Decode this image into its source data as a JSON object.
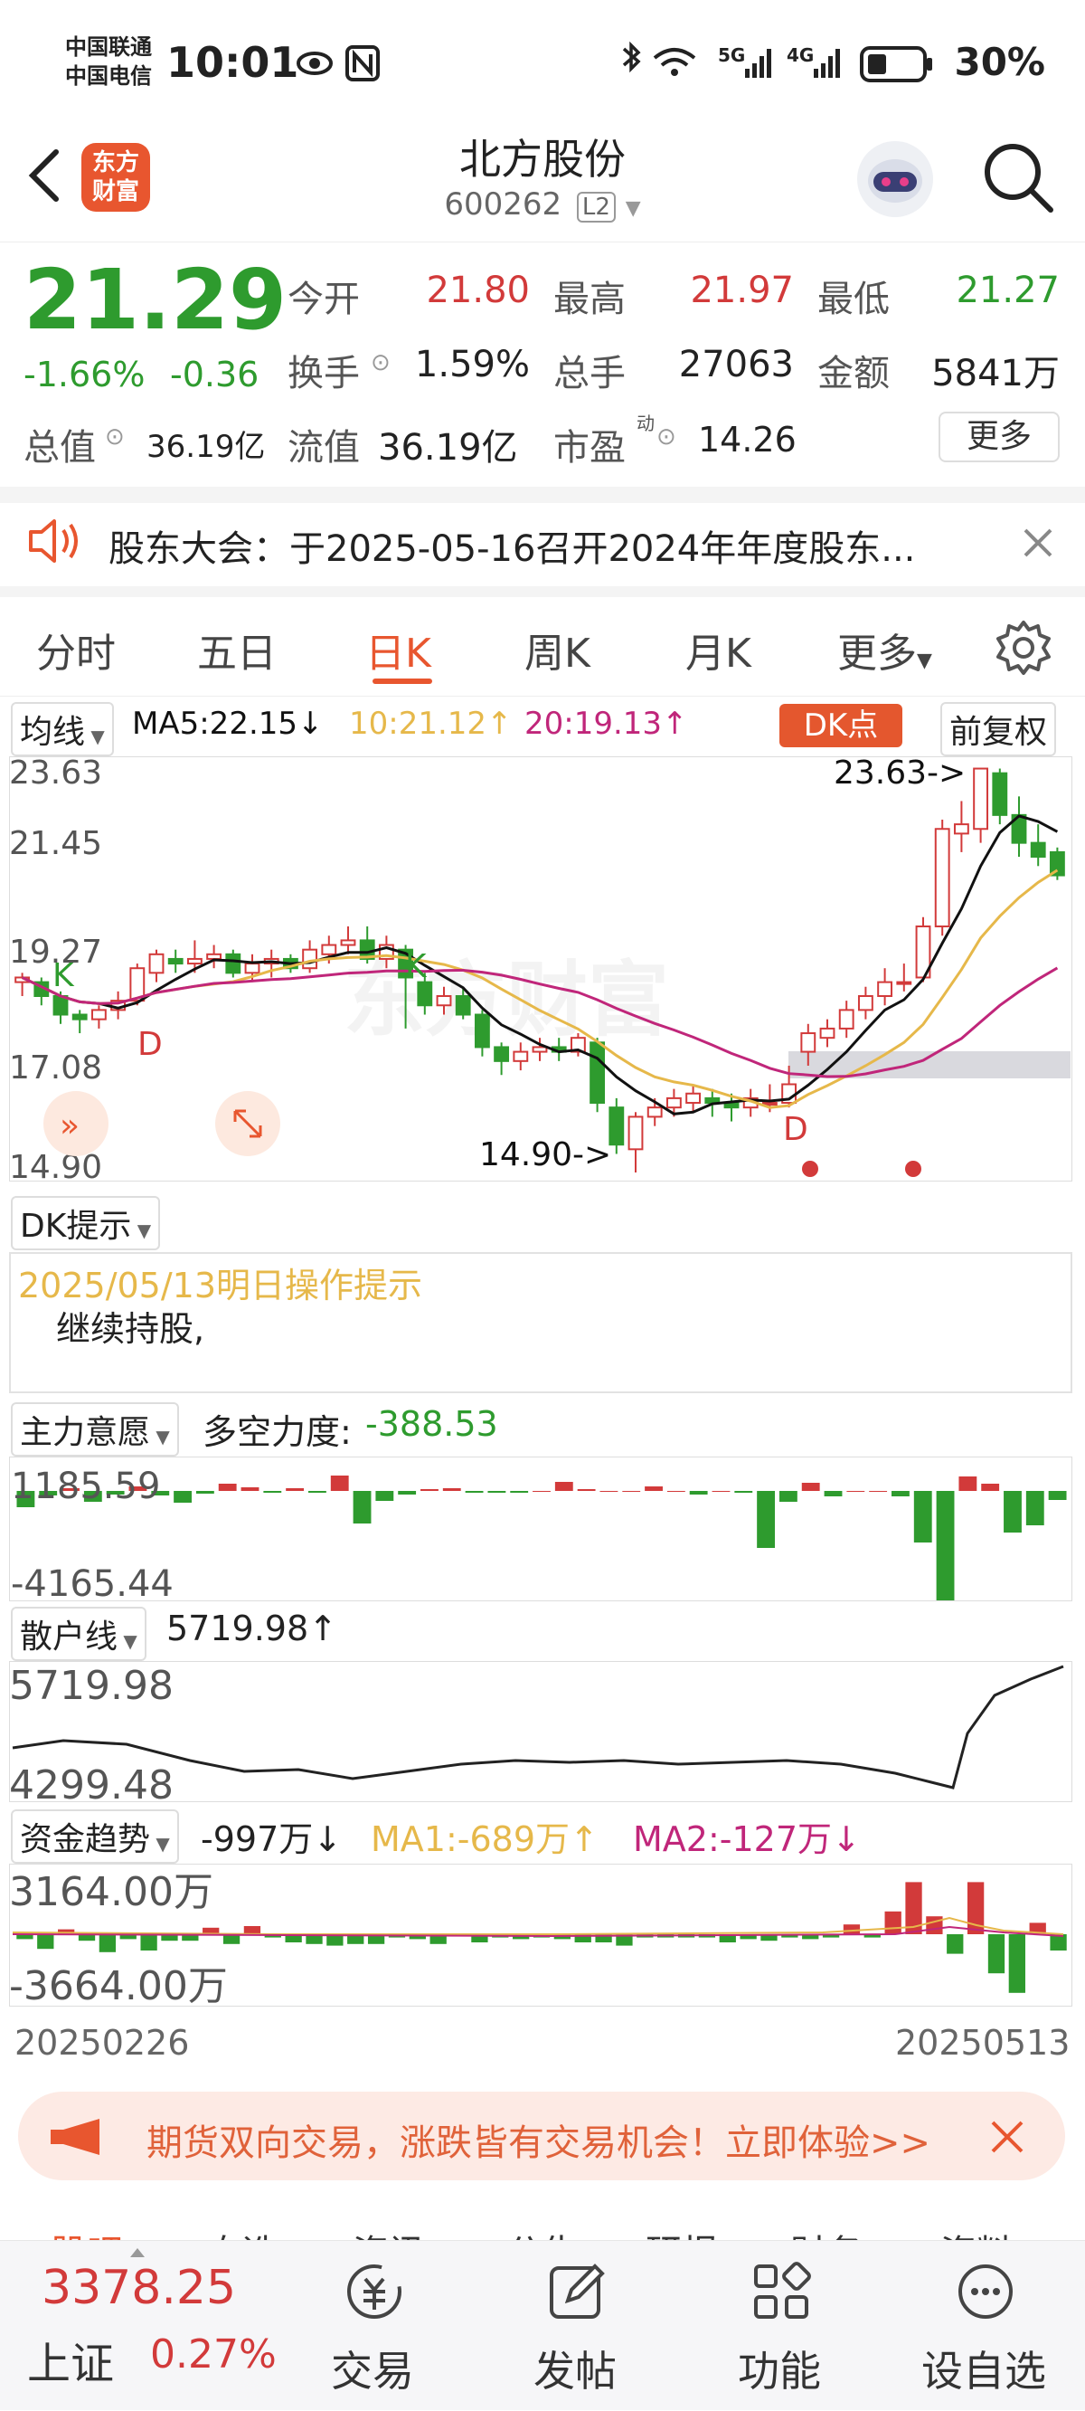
{
  "status_bar": {
    "carrier_1": "中国联通",
    "carrier_2": "中国电信",
    "time": "10:01",
    "battery": "30%",
    "signal_labels": [
      "5G",
      "4G"
    ]
  },
  "header": {
    "logo_text_1": "东方",
    "logo_text_2": "财富",
    "title": "北方股份",
    "code": "600262",
    "level": "L2"
  },
  "quote": {
    "price": "21.29",
    "change_pct": "-1.66%",
    "change": "-0.36",
    "open_label": "今开",
    "open": "21.80",
    "high_label": "最高",
    "high": "21.97",
    "low_label": "最低",
    "low": "21.27",
    "turnover_label": "换手",
    "turnover": "1.59%",
    "volume_label": "总手",
    "volume": "27063",
    "amount_label": "金额",
    "amount": "5841万",
    "mktcap_label": "总值",
    "mktcap": "36.19亿",
    "float_label": "流值",
    "float_cap": "36.19亿",
    "pe_label": "市盈",
    "pe_sup": "动",
    "pe": "14.26",
    "more_button": "更多"
  },
  "notice": {
    "text": "股东大会：于2025-05-16召开2024年年度股东..."
  },
  "tabs": {
    "items": [
      "分时",
      "五日",
      "日K",
      "周K",
      "月K",
      "更多"
    ],
    "active": "日K"
  },
  "chart": {
    "ma_selector": "均线",
    "ma5": "MA5:22.15",
    "ma10": "10:21.12",
    "ma20": "20:19.13",
    "dk_button": "DK点",
    "adjust_button": "前复权",
    "y_labels": [
      "23.63",
      "21.45",
      "19.27",
      "17.08",
      "14.90"
    ],
    "high_marker": "23.63->",
    "low_marker": "14.90->",
    "signals": [
      "K",
      "D",
      "K",
      "D"
    ],
    "dk_selector": "DK提示",
    "dk_date": "2025/05/13明日操作提示",
    "dk_text": "继续持股,",
    "force_selector": "主力意愿",
    "force_label": "多空力度:",
    "force_value": "-388.53",
    "force_y_top": "1185.59",
    "force_y_bottom": "-4165.44",
    "retail_selector": "散户线",
    "retail_value": "5719.98",
    "retail_y_top": "5719.98",
    "retail_y_bottom": "4299.48",
    "fund_selector": "资金趋势",
    "fund_value": "-997万",
    "fund_ma1": "MA1:-689万",
    "fund_ma2": "MA2:-127万",
    "fund_y_top": "3164.00万",
    "fund_y_bottom": "-3664.00万",
    "date_start": "20250226",
    "date_end": "20250513",
    "colors": {
      "up": "#d23a3a",
      "down": "#2e9b2e",
      "ma5": "#111111",
      "ma10": "#e6b84a",
      "ma20": "#c0267a",
      "dk_btn": "#e4572e"
    }
  },
  "chart_data": {
    "type": "candlestick",
    "ylim": [
      14.9,
      23.63
    ],
    "candles": [
      [
        19.0,
        19.1,
        18.7,
        19.2
      ],
      [
        19.0,
        18.7,
        18.5,
        19.1
      ],
      [
        18.7,
        18.3,
        18.1,
        18.8
      ],
      [
        18.3,
        18.2,
        17.9,
        18.4
      ],
      [
        18.2,
        18.4,
        18.0,
        18.5
      ],
      [
        18.4,
        18.6,
        18.2,
        18.8
      ],
      [
        18.6,
        19.3,
        18.5,
        19.4
      ],
      [
        19.2,
        19.6,
        19.0,
        19.7
      ],
      [
        19.5,
        19.4,
        19.2,
        19.7
      ],
      [
        19.4,
        19.5,
        19.2,
        19.9
      ],
      [
        19.5,
        19.6,
        19.3,
        19.8
      ],
      [
        19.6,
        19.2,
        19.1,
        19.7
      ],
      [
        19.2,
        19.4,
        19.0,
        19.6
      ],
      [
        19.4,
        19.5,
        19.1,
        19.7
      ],
      [
        19.5,
        19.3,
        19.2,
        19.6
      ],
      [
        19.3,
        19.7,
        19.2,
        19.9
      ],
      [
        19.6,
        19.8,
        19.4,
        20.0
      ],
      [
        19.8,
        19.9,
        19.6,
        20.2
      ],
      [
        19.9,
        19.5,
        19.4,
        20.2
      ],
      [
        19.5,
        19.8,
        19.3,
        20.0
      ],
      [
        19.7,
        19.1,
        18.0,
        19.8
      ],
      [
        19.0,
        18.5,
        18.3,
        19.2
      ],
      [
        18.5,
        18.7,
        18.3,
        18.9
      ],
      [
        18.7,
        18.3,
        18.2,
        18.9
      ],
      [
        18.3,
        17.6,
        17.4,
        18.4
      ],
      [
        17.6,
        17.3,
        17.0,
        17.7
      ],
      [
        17.3,
        17.5,
        17.1,
        17.7
      ],
      [
        17.5,
        17.6,
        17.3,
        17.8
      ],
      [
        17.6,
        17.5,
        17.3,
        17.8
      ],
      [
        17.5,
        17.8,
        17.4,
        17.9
      ],
      [
        17.7,
        16.4,
        16.2,
        17.8
      ],
      [
        16.3,
        15.5,
        15.3,
        16.5
      ],
      [
        15.4,
        16.1,
        14.9,
        16.2
      ],
      [
        16.1,
        16.3,
        15.9,
        16.5
      ],
      [
        16.3,
        16.5,
        16.1,
        16.7
      ],
      [
        16.4,
        16.6,
        16.2,
        16.8
      ],
      [
        16.5,
        16.4,
        16.1,
        16.7
      ],
      [
        16.4,
        16.3,
        16.0,
        16.6
      ],
      [
        16.3,
        16.5,
        16.1,
        16.7
      ],
      [
        16.4,
        16.4,
        16.2,
        16.8
      ],
      [
        16.4,
        16.8,
        16.3,
        17.2
      ],
      [
        17.5,
        17.9,
        17.2,
        18.1
      ],
      [
        17.8,
        18.0,
        17.6,
        18.2
      ],
      [
        18.0,
        18.4,
        17.8,
        18.6
      ],
      [
        18.4,
        18.7,
        18.2,
        18.9
      ],
      [
        18.7,
        19.0,
        18.5,
        19.3
      ],
      [
        19.0,
        19.0,
        18.8,
        19.4
      ],
      [
        19.1,
        20.2,
        19.0,
        20.4
      ],
      [
        20.2,
        22.3,
        20.0,
        22.5
      ],
      [
        22.2,
        22.4,
        21.8,
        22.9
      ],
      [
        22.3,
        23.6,
        22.0,
        23.6
      ],
      [
        23.5,
        22.6,
        22.4,
        23.6
      ],
      [
        22.6,
        22.0,
        21.7,
        23.0
      ],
      [
        22.0,
        21.7,
        21.5,
        22.4
      ],
      [
        21.8,
        21.3,
        21.2,
        21.9
      ]
    ],
    "force_bars": [
      -1.8,
      -0.5,
      0.3,
      -1.2,
      -0.4,
      0.5,
      -0.5,
      -1.3,
      -0.3,
      0.8,
      0.4,
      -0.2,
      0.3,
      -0.2,
      1.7,
      -3.6,
      -1.1,
      -0.4,
      0.2,
      0.3,
      -0.2,
      -0.2,
      -0.2,
      0.0,
      1.0,
      0.2,
      0.0,
      0.0,
      0.5,
      0.0,
      -0.4,
      0.0,
      -0.2,
      -6.3,
      -1.2,
      0.9,
      -0.6,
      0.0,
      0.0,
      -0.6,
      -5.7,
      -12.1,
      1.6,
      0.8,
      -4.6,
      -3.8,
      -1.0
    ],
    "fund_bars": [
      -0.3,
      -0.9,
      0.3,
      -0.4,
      -1.1,
      -0.3,
      -1.0,
      -0.4,
      -0.4,
      0.4,
      -0.6,
      0.5,
      -0.2,
      -0.5,
      -0.6,
      -0.7,
      -0.6,
      -0.6,
      -0.2,
      -0.3,
      -0.6,
      0.0,
      -0.5,
      -0.2,
      -0.3,
      -0.2,
      -0.3,
      -0.5,
      -0.5,
      -0.7,
      -0.2,
      -0.2,
      -0.2,
      -0.2,
      -0.5,
      -0.3,
      -0.4,
      -0.2,
      -0.3,
      -0.2,
      0.6,
      -0.2,
      1.4,
      3.2,
      1.1,
      -1.2,
      3.2,
      -2.4,
      -3.6,
      0.7,
      -1.0
    ]
  },
  "banner": {
    "text": "期货双向交易，涨跌皆有交易机会！立即体验>>"
  },
  "bottom_nav": {
    "index_value": "3378.25",
    "index_name": "上证",
    "index_change": "0.27%",
    "items": [
      "交易",
      "发帖",
      "功能",
      "设自选"
    ],
    "hidden_tabs": [
      "股吧",
      "自选",
      "资讯",
      "公告",
      "研报",
      "财务",
      "资料"
    ]
  }
}
